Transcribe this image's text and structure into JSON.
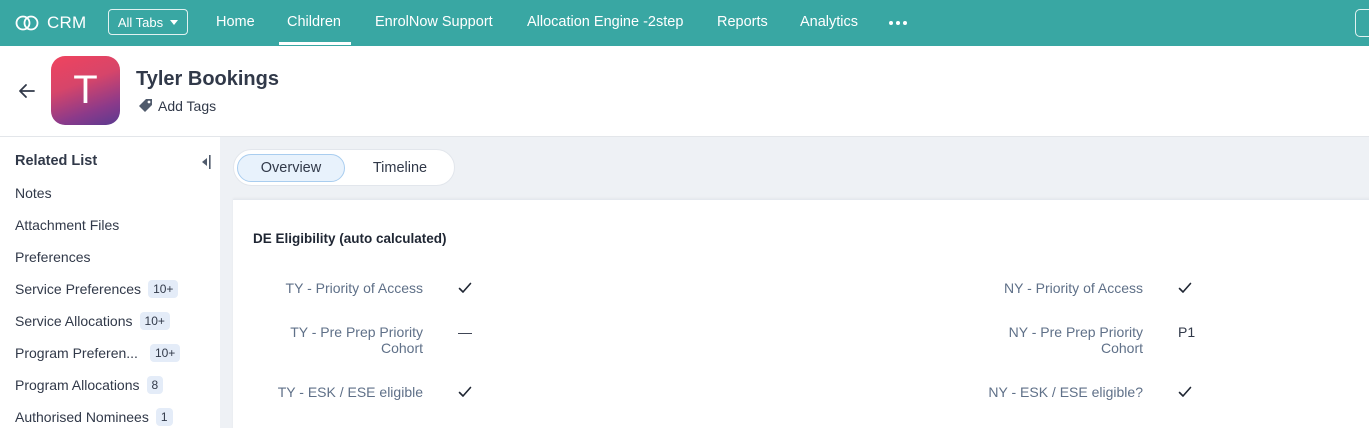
{
  "topnav": {
    "brand": "CRM",
    "all_tabs": "All Tabs",
    "tabs": [
      "Home",
      "Children",
      "EnrolNow Support",
      "Allocation Engine -2step",
      "Reports",
      "Analytics"
    ],
    "active_tab": "Children",
    "accent": "#39a7a3"
  },
  "record": {
    "avatar_letter": "T",
    "title": "Tyler Bookings",
    "add_tags": "Add Tags"
  },
  "sidebar": {
    "title": "Related List",
    "items": [
      {
        "label": "Notes",
        "badge": ""
      },
      {
        "label": "Attachment Files",
        "badge": ""
      },
      {
        "label": "Preferences",
        "badge": ""
      },
      {
        "label": "Service Preferences",
        "badge": "10+"
      },
      {
        "label": "Service Allocations",
        "badge": "10+"
      },
      {
        "label": "Program Preferen...",
        "badge": "10+"
      },
      {
        "label": "Program Allocations",
        "badge": "8"
      },
      {
        "label": "Authorised Nominees",
        "badge": "1"
      }
    ]
  },
  "main": {
    "tabs": [
      "Overview",
      "Timeline"
    ],
    "active_tab": "Overview",
    "section_title": "DE Eligibility (auto calculated)",
    "fields_left": [
      {
        "label": "TY - Priority of Access",
        "value": "check"
      },
      {
        "label": "TY - Pre Prep Priority Cohort",
        "value": "—"
      },
      {
        "label": "TY - ESK / ESE eligible",
        "value": "check"
      }
    ],
    "fields_right": [
      {
        "label": "NY - Priority of Access",
        "value": "check"
      },
      {
        "label": "NY - Pre Prep Priority Cohort",
        "value": "P1"
      },
      {
        "label": "NY - ESK / ESE eligible?",
        "value": "check"
      }
    ]
  }
}
